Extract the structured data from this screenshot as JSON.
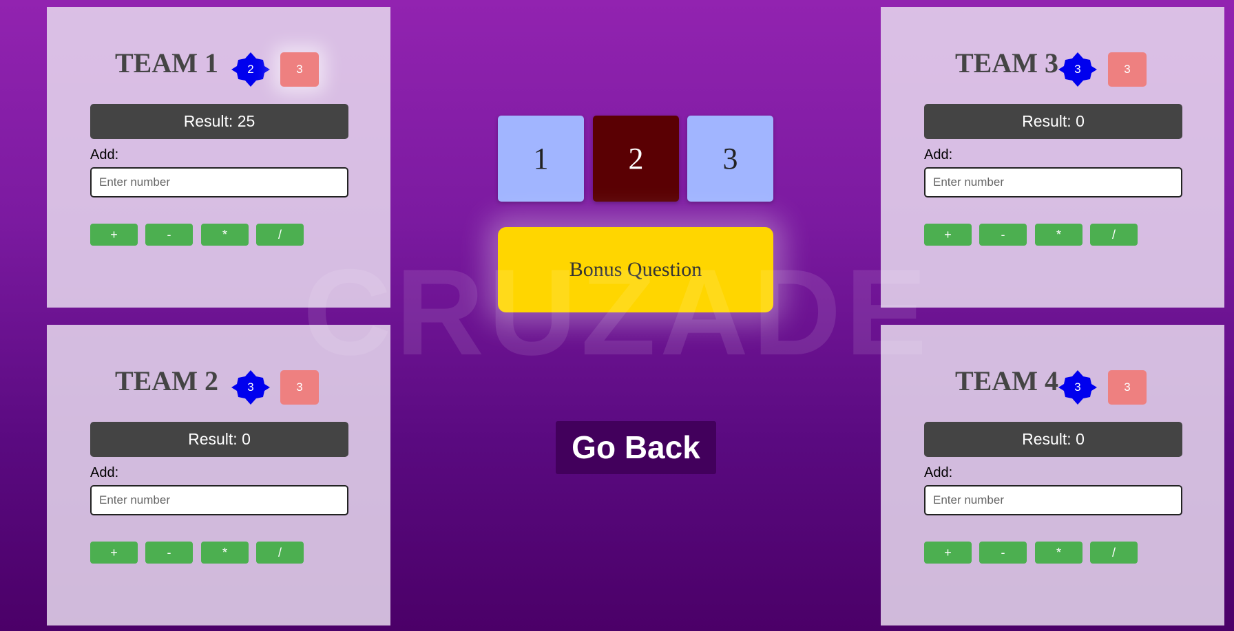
{
  "watermark": "CRUZADE",
  "teams": [
    {
      "name": "TEAM 1",
      "star_value": "2",
      "badge_value": "3",
      "result": "Result: 25",
      "add_label": "Add:",
      "input_placeholder": "Enter number"
    },
    {
      "name": "TEAM 2",
      "star_value": "3",
      "badge_value": "3",
      "result": "Result: 0",
      "add_label": "Add:",
      "input_placeholder": "Enter number"
    },
    {
      "name": "TEAM 3",
      "star_value": "3",
      "badge_value": "3",
      "result": "Result: 0",
      "add_label": "Add:",
      "input_placeholder": "Enter number"
    },
    {
      "name": "TEAM 4",
      "star_value": "3",
      "badge_value": "3",
      "result": "Result: 0",
      "add_label": "Add:",
      "input_placeholder": "Enter number"
    }
  ],
  "operations": [
    "+",
    "-",
    "*",
    "/"
  ],
  "question_boxes": [
    {
      "label": "1",
      "selected": false
    },
    {
      "label": "2",
      "selected": true
    },
    {
      "label": "3",
      "selected": false
    }
  ],
  "bonus_button": "Bonus Question",
  "go_back_button": "Go Back",
  "colors": {
    "star": "#0000ee",
    "badge": "#ee8080",
    "result_bg": "#444444",
    "op_button": "#4caf50",
    "question_box": "#a1b5ff",
    "question_box_selected": "#5a0003",
    "bonus": "#ffd600",
    "go_back": "#42005c"
  },
  "icons": {
    "star": "star-badge-icon"
  }
}
